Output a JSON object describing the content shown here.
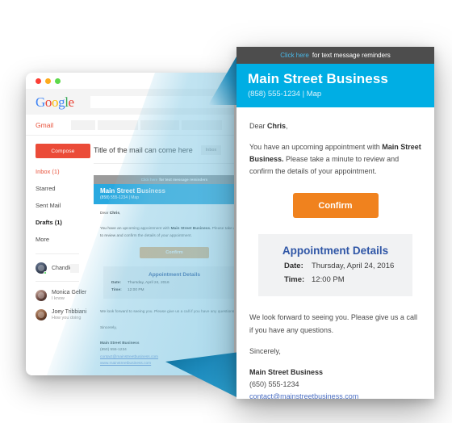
{
  "colors": {
    "cyan": "#00AEE4",
    "orange": "#F0821E",
    "grey_header": "#4D4D4D",
    "link_blue": "#4B6FC4",
    "heading_blue": "#2F56A6",
    "gmail_red": "#EB4B38"
  },
  "gmail": {
    "window_controls": [
      "close-red",
      "minimize-yellow",
      "maximize-green"
    ],
    "logo": [
      "G",
      "o",
      "o",
      "g",
      "l",
      "e"
    ],
    "gmail_label": "Gmail",
    "search_placeholder": "",
    "compose_label": "Compose",
    "nav": [
      {
        "label": "Inbox (1)",
        "state": "active"
      },
      {
        "label": "Starred",
        "state": "normal"
      },
      {
        "label": "Sent Mail",
        "state": "normal"
      },
      {
        "label": "Drafts (1)",
        "state": "bold"
      },
      {
        "label": "More",
        "state": "normal"
      }
    ],
    "contacts": [
      {
        "name": "Chandler",
        "snippet": "",
        "online": true
      },
      {
        "name": "Monica Geller",
        "snippet": "I know",
        "online": false
      },
      {
        "name": "Joey Tribbiani",
        "snippet": "How you doing",
        "online": false
      }
    ],
    "mail_title": "Title of the mail can come here",
    "mail_chip": "Inbox"
  },
  "email": {
    "banner": {
      "link": "Click here",
      "rest": "for text message reminders"
    },
    "business_name": "Main Street Business",
    "business_contact": "(858) 555-1234 | Map",
    "greeting_pre": "Dear ",
    "greeting_name": "Chris",
    "greeting_post": ",",
    "para1_a": "You have an upcoming appointment with ",
    "para1_b": "Main Street Business.",
    "para1_c": " Please take a minute to review and confirm the details of your appointment.",
    "confirm_label": "Confirm",
    "details_heading": "Appointment Details",
    "details": [
      {
        "key": "Date:",
        "value": "Thursday, April 24, 2016"
      },
      {
        "key": "Time:",
        "value": "12:00 PM"
      }
    ],
    "closing": "We look forward to seeing you. Please give us a call if you have any questions.",
    "sincerely": "Sincerely,",
    "sig_name": "Main Street Business",
    "sig_phone": "(650) 555-1234",
    "sig_email": "contact@mainstreetbusiness.com",
    "sig_site": "www.mainstreetbusiness.com"
  }
}
